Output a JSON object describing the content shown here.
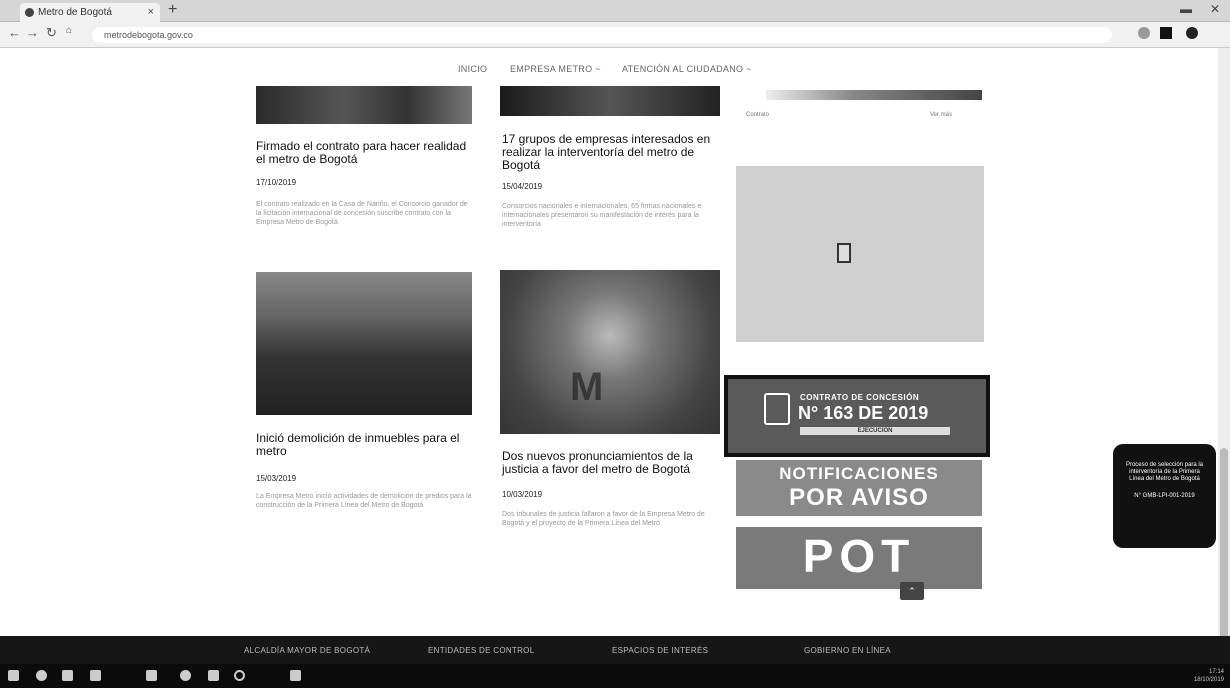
{
  "browser": {
    "tab_title": "Metro de Bogotá",
    "tab_close": "×",
    "new_tab": "+",
    "url": "metrodebogota.gov.co"
  },
  "menu": {
    "items": [
      "INICIO",
      "EMPRESA METRO ~",
      "ATENCIÓN AL CIUDADANO ~"
    ]
  },
  "news": [
    {
      "title": "Firmado el contrato para hacer realidad el metro de Bogotá",
      "date": "17/10/2019",
      "text": "El contrato realizado en la Casa de Nariño, el Consorcio ganador de la licitación internacional de concesión suscribe contrato con la Empresa Metro de Bogotá"
    },
    {
      "title": "17 grupos de empresas interesados en realizar la interventoría del metro de Bogotá",
      "date": "15/04/2019",
      "text": "Consorcios nacionales e internacionales, 65 firmas nacionales e internacionales presentaron su manifestación de interés para la interventoría"
    },
    {
      "title": "Inició demolición de inmuebles para el metro",
      "date": "15/03/2019",
      "text": "La Empresa Metro inició actividades de demolición de predios para la construcción de la Primera Línea del Metro de Bogotá"
    },
    {
      "title": "Dos nuevos pronunciamientos de la justicia a favor del metro de Bogotá",
      "date": "10/03/2019",
      "text": "Dos tribunales de justicia fallaron a favor de la Empresa Metro de Bogotá y el proyecto de la Primera Línea del Metro"
    }
  ],
  "sidebar": {
    "caption_left": "Contrato",
    "caption_right": "Ver más",
    "banner1_line1": "CONTRATO DE CONCESIÓN",
    "banner1_line2": "N° 163 DE 2019",
    "banner1_line3": "EJECUCIÓN",
    "banner2_line1": "NOTIFICACIONES",
    "banner2_line2": "POR AVISO",
    "banner3": "POT",
    "up_button": "⌃"
  },
  "chat": {
    "text": "Proceso de selección para la interventoría de la Primera Línea del Metro de Bogotá",
    "number": "N° GMB-LPI-001-2019"
  },
  "footer": {
    "links": [
      "ALCALDÍA MAYOR DE BOGOTÁ",
      "ENTIDADES DE CONTROL",
      "ESPACIOS DE INTERÉS",
      "GOBIERNO EN LÍNEA"
    ]
  },
  "taskbar": {
    "time": "17:14",
    "date": "18/10/2019"
  },
  "colors": {
    "footer_bg": "#161616",
    "banner_dark": "#5a5a5a"
  }
}
